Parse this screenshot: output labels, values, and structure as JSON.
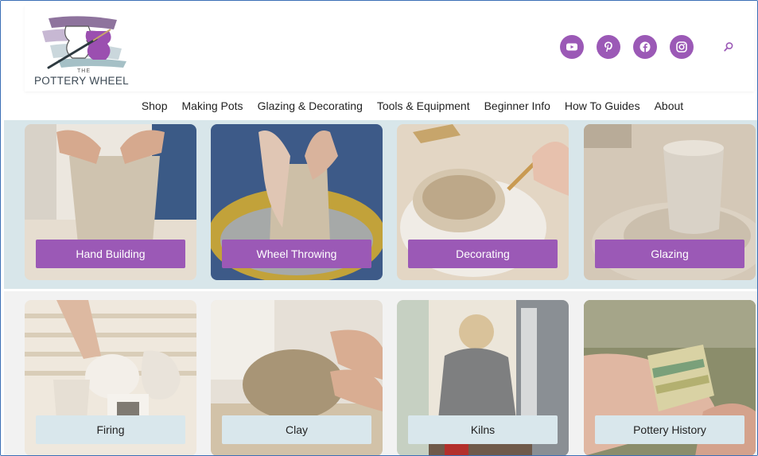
{
  "brand": {
    "logo_small": "THE",
    "logo_text": "POTTERY WHEEL",
    "accent": "#9b59b6",
    "label_light": "#d9e7ec"
  },
  "socials": [
    {
      "name": "youtube-icon"
    },
    {
      "name": "pinterest-icon"
    },
    {
      "name": "facebook-icon"
    },
    {
      "name": "instagram-icon"
    }
  ],
  "nav": {
    "items": [
      {
        "label": "Shop"
      },
      {
        "label": "Making Pots"
      },
      {
        "label": "Glazing & Decorating"
      },
      {
        "label": "Tools & Equipment"
      },
      {
        "label": "Beginner Info"
      },
      {
        "label": "How To Guides"
      },
      {
        "label": "About"
      }
    ]
  },
  "categories": {
    "row1": [
      {
        "label": "Hand Building"
      },
      {
        "label": "Wheel Throwing"
      },
      {
        "label": "Decorating"
      },
      {
        "label": "Glazing"
      }
    ],
    "row2": [
      {
        "label": "Firing"
      },
      {
        "label": "Clay"
      },
      {
        "label": "Kilns"
      },
      {
        "label": "Pottery History"
      }
    ]
  }
}
